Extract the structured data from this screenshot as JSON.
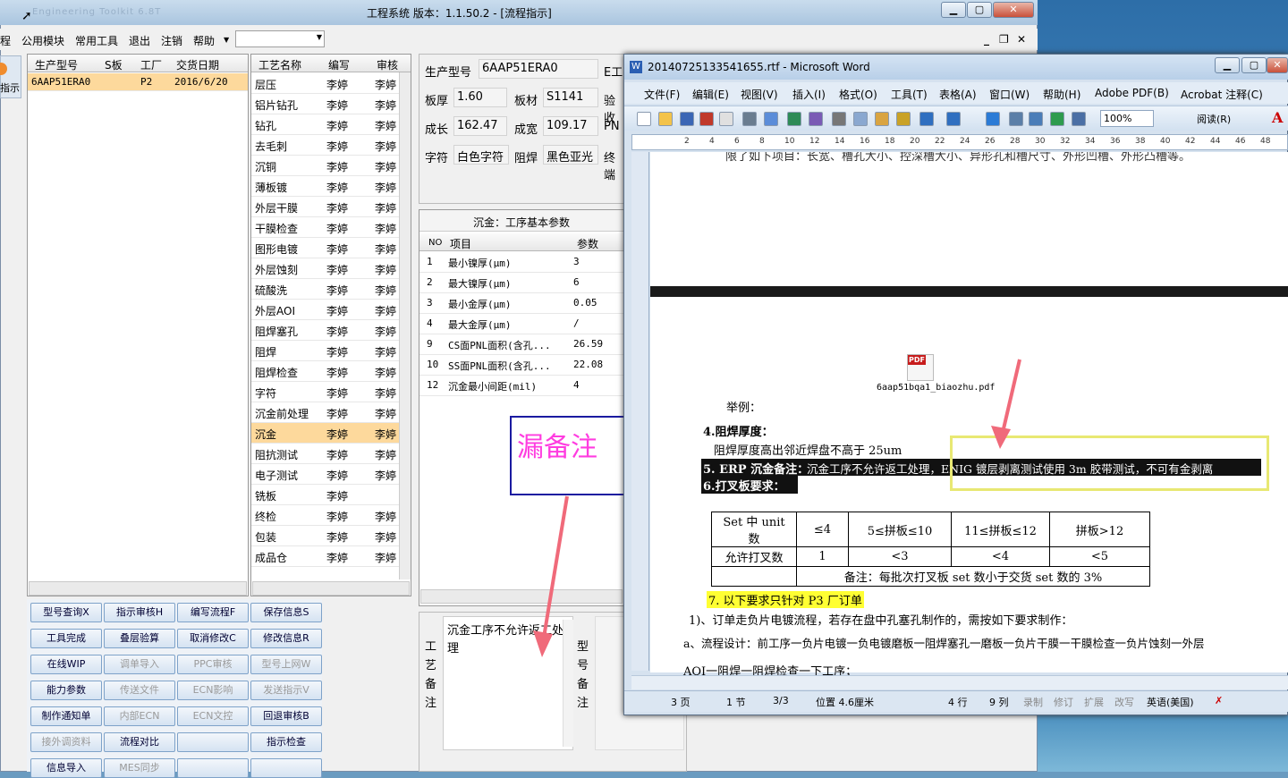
{
  "app": {
    "title": "工程系统   版本：1.1.50.2 - [流程指示]",
    "blurred_title": "Engineering Toolkit 6.8T"
  },
  "menubar": {
    "items": [
      "程",
      "公用模块",
      "常用工具",
      "退出",
      "注销",
      "帮助"
    ],
    "mdi_buttons": [
      "_",
      "❐",
      "✕"
    ]
  },
  "left_strip": {
    "label": "指示"
  },
  "order_grid": {
    "headers": [
      "生产型号",
      "S板",
      "工厂",
      "交货日期"
    ],
    "rows": [
      [
        "6AAP51ERA0",
        "",
        "P2",
        "2016/6/20"
      ]
    ]
  },
  "process_grid": {
    "headers": [
      "工艺名称",
      "编写",
      "审核"
    ],
    "rows": [
      [
        "层压",
        "李婷",
        "李婷"
      ],
      [
        "铝片钻孔",
        "李婷",
        "李婷"
      ],
      [
        "钻孔",
        "李婷",
        "李婷"
      ],
      [
        "去毛刺",
        "李婷",
        "李婷"
      ],
      [
        "沉铜",
        "李婷",
        "李婷"
      ],
      [
        "薄板镀",
        "李婷",
        "李婷"
      ],
      [
        "外层干膜",
        "李婷",
        "李婷"
      ],
      [
        "干膜检查",
        "李婷",
        "李婷"
      ],
      [
        "图形电镀",
        "李婷",
        "李婷"
      ],
      [
        "外层蚀刻",
        "李婷",
        "李婷"
      ],
      [
        "硫酸洗",
        "李婷",
        "李婷"
      ],
      [
        "外层AOI",
        "李婷",
        "李婷"
      ],
      [
        "阻焊塞孔",
        "李婷",
        "李婷"
      ],
      [
        "阻焊",
        "李婷",
        "李婷"
      ],
      [
        "阻焊检查",
        "李婷",
        "李婷"
      ],
      [
        "字符",
        "李婷",
        "李婷"
      ],
      [
        "沉金前处理",
        "李婷",
        "李婷"
      ],
      [
        "沉金",
        "李婷",
        "李婷"
      ],
      [
        "阻抗测试",
        "李婷",
        "李婷"
      ],
      [
        "电子测试",
        "李婷",
        "李婷"
      ],
      [
        "铣板",
        "李婷",
        ""
      ],
      [
        "终检",
        "李婷",
        "李婷"
      ],
      [
        "包装",
        "李婷",
        "李婷"
      ],
      [
        "成品仓",
        "李婷",
        "李婷"
      ]
    ],
    "selected_index": 17
  },
  "product_info": {
    "model_label": "生产型号",
    "model": "6AAP51ERA0",
    "e_label": "E工",
    "thickness_label": "板厚",
    "thickness": "1.60",
    "material_label": "板材",
    "material": "S1141",
    "check_label": "验收",
    "length_label": "成长",
    "length": "162.47",
    "width_label": "成宽",
    "width": "109.17",
    "pn_label": "PN",
    "char_label": "字符",
    "char": "白色字符",
    "mask_label": "阻焊",
    "mask": "黑色亚光",
    "final_label": "终端"
  },
  "params_grid": {
    "title": "沉金：工序基本参数",
    "headers": [
      "NO",
      "项目",
      "参数"
    ],
    "rows": [
      [
        "1",
        "最小镍厚(μm)",
        "3"
      ],
      [
        "2",
        "最大镍厚(μm)",
        "6"
      ],
      [
        "3",
        "最小金厚(μm)",
        "0.05"
      ],
      [
        "4",
        "最大金厚(μm)",
        "/"
      ],
      [
        "9",
        "CS面PNL面积(含孔...",
        "26.59"
      ],
      [
        "10",
        "SS面PNL面积(含孔...",
        "22.08"
      ],
      [
        "12",
        "沉金最小间距(mil)",
        "4"
      ]
    ]
  },
  "remarks": {
    "process_label": "工艺备注",
    "process_text": "沉金工序不允许返工处理",
    "model_label": "型号备注"
  },
  "buttons": [
    [
      "型号查询X",
      "指示审核H",
      "编写流程F",
      "保存信息S"
    ],
    [
      "工具完成",
      "叠层验算",
      "取消修改C",
      "修改信息R"
    ],
    [
      "在线WIP",
      "调单导入",
      "PPC审核",
      "型号上网W"
    ],
    [
      "能力参数",
      "传送文件",
      "ECN影响",
      "发送指示V"
    ],
    [
      "制作通知单",
      "内部ECN",
      "ECN文控",
      "回退审核B"
    ],
    [
      "接外调资料",
      "流程对比",
      "",
      "指示检查"
    ],
    [
      "信息导入",
      "MES同步",
      "",
      ""
    ]
  ],
  "disabled_buttons": [
    "调单导入",
    "PPC审核",
    "型号上网W",
    "传送文件",
    "ECN影响",
    "发送指示V",
    "内部ECN",
    "ECN文控",
    "接外调资料",
    "MES同步"
  ],
  "annotation": {
    "text": "漏备注"
  },
  "word": {
    "title": "20140725133541655.rtf - Microsoft Word",
    "menu": [
      "文件(F)",
      "编辑(E)",
      "视图(V)",
      "插入(I)",
      "格式(O)",
      "工具(T)",
      "表格(A)",
      "窗口(W)",
      "帮助(H)",
      "Adobe PDF(B)",
      "Acrobat 注释(C)"
    ],
    "zoom": "100%",
    "read_label": "阅读(R)",
    "ruler_ticks": [
      "2",
      "4",
      "6",
      "8",
      "10",
      "12",
      "14",
      "16",
      "18",
      "20",
      "22",
      "24",
      "26",
      "28",
      "30",
      "32",
      "34",
      "36",
      "38",
      "40",
      "42",
      "44",
      "46",
      "48"
    ],
    "doc": {
      "top_line": "限了如下项目：长宽、槽孔大小、控深槽大小、异形孔和槽尺寸、外形凹槽、外形凸槽等。",
      "pdf_name": "6aap51bqa1_biaozhu.pdf",
      "example": "举例：",
      "sec4": "4.阻焊厚度：",
      "sec4_body": "阻焊厚度高出邻近焊盘不高于 25um",
      "sec5a": "5. ERP 沉金备注：",
      "sec5b": "沉金工序不允许返工处理，ENIG 镀层剥离测试使用 3m 胶带测试，不可有金剥离",
      "sec6": "6.打叉板要求：",
      "table": {
        "row1": [
          "Set 中 unit 数",
          "≤4",
          "5≤拼板≤10",
          "11≤拼板≤12",
          "拼板>12"
        ],
        "row2": [
          "允许打叉数",
          "1",
          "<3",
          "<4",
          "<5"
        ],
        "note": "备注：每批次打叉板 set 数小于交货 set 数的 3%"
      },
      "sec7": "7.  以下要求只针对 P3 厂订单",
      "item1": "1)、订单走负片电镀流程，若存在盘中孔塞孔制作的，需按如下要求制作：",
      "itema": "a、流程设计：前工序一负片电镀一负电镀磨板一阻焊塞孔一磨板一负片干膜一干膜检查一负片蚀刻一外层",
      "itemb": "AOI一阻焊一阻焊检查一下工序；"
    },
    "status": [
      "3 页",
      "1 节",
      "3/3",
      "位置 4.6厘米",
      "4 行",
      "9 列",
      "录制",
      "修订",
      "扩展",
      "改写",
      "英语(美国)"
    ]
  }
}
